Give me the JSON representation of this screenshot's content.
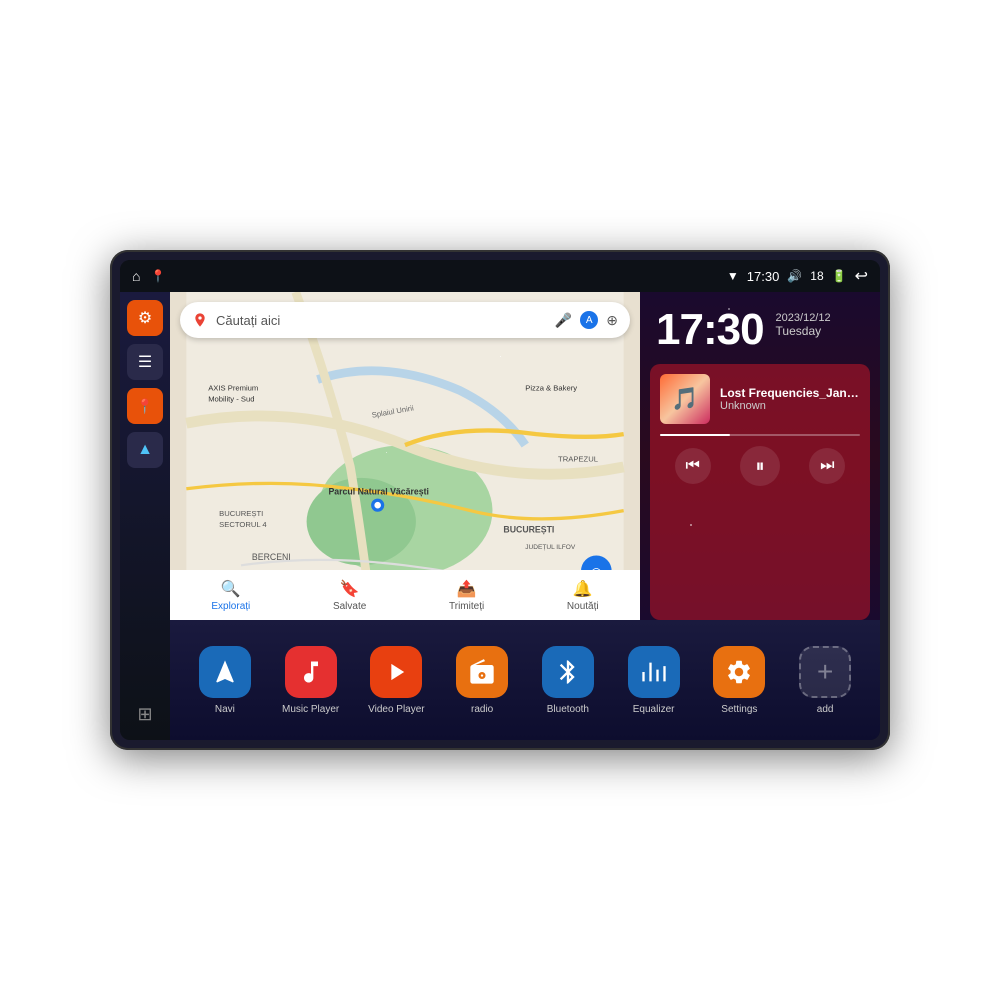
{
  "device": {
    "status_bar": {
      "left_icons": [
        "home",
        "location"
      ],
      "wifi_icon": "▼",
      "time": "17:30",
      "volume_icon": "🔊",
      "battery_level": "18",
      "battery_icon": "🔋",
      "back_icon": "↩"
    },
    "sidebar": {
      "buttons": [
        {
          "id": "settings",
          "icon": "⚙",
          "color": "orange"
        },
        {
          "id": "files",
          "icon": "☰",
          "color": "dark"
        },
        {
          "id": "maps",
          "icon": "📍",
          "color": "orange"
        },
        {
          "id": "nav",
          "icon": "▲",
          "color": "dark"
        }
      ],
      "bottom": {
        "id": "grid",
        "icon": "⊞"
      }
    },
    "map": {
      "search_placeholder": "Căutați aici",
      "locations": [
        "AXIS Premium Mobility - Sud",
        "Parcul Natural Văcărești",
        "Pizza & Bakery",
        "TRAPEZUL",
        "BUCUREȘTI",
        "BUCUREȘTI SECTORUL 4",
        "JUDEȚUL ILFOV",
        "BERCENI"
      ],
      "bottom_items": [
        {
          "icon": "🔍",
          "label": "Explorați"
        },
        {
          "icon": "🔖",
          "label": "Salvate"
        },
        {
          "icon": "📤",
          "label": "Trimiteți"
        },
        {
          "icon": "🔔",
          "label": "Noutăți"
        }
      ]
    },
    "clock": {
      "time": "17:30",
      "date": "2023/12/12",
      "day": "Tuesday"
    },
    "music": {
      "title": "Lost Frequencies_Janie...",
      "artist": "Unknown",
      "controls": {
        "prev": "⏮",
        "pause": "⏸",
        "next": "⏭"
      }
    },
    "apps": [
      {
        "id": "navi",
        "icon": "▲",
        "label": "Navi",
        "color": "blue"
      },
      {
        "id": "music-player",
        "icon": "♪",
        "label": "Music Player",
        "color": "red"
      },
      {
        "id": "video-player",
        "icon": "▶",
        "label": "Video Player",
        "color": "orange-red"
      },
      {
        "id": "radio",
        "icon": "📻",
        "label": "radio",
        "color": "orange"
      },
      {
        "id": "bluetooth",
        "icon": "⚡",
        "label": "Bluetooth",
        "color": "blue-bt"
      },
      {
        "id": "equalizer",
        "icon": "≡",
        "label": "Equalizer",
        "color": "eq"
      },
      {
        "id": "settings",
        "icon": "⚙",
        "label": "Settings",
        "color": "settings-org"
      },
      {
        "id": "add",
        "icon": "+",
        "label": "add",
        "color": "add-gray"
      }
    ]
  }
}
